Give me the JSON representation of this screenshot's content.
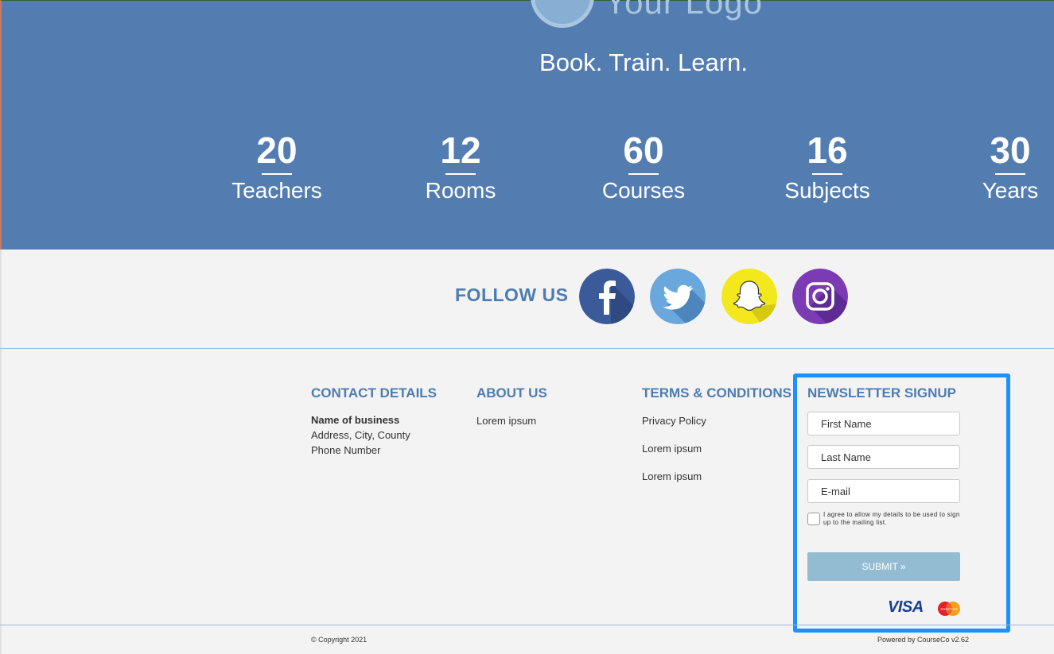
{
  "hero": {
    "logo_text": "Your Logo",
    "tagline": "Book. Train. Learn.",
    "stats": [
      {
        "number": "20",
        "label": "Teachers"
      },
      {
        "number": "12",
        "label": "Rooms"
      },
      {
        "number": "60",
        "label": "Courses"
      },
      {
        "number": "16",
        "label": "Subjects"
      },
      {
        "number": "30",
        "label": "Years"
      }
    ]
  },
  "follow": {
    "label": "FOLLOW US",
    "icons": [
      "facebook-icon",
      "twitter-icon",
      "snapchat-icon",
      "instagram-icon"
    ]
  },
  "contact": {
    "heading": "CONTACT DETAILS",
    "business_name": "Name of business",
    "address": "Address, City, County",
    "phone": "Phone Number"
  },
  "about": {
    "heading": "ABOUT US",
    "links": [
      "Lorem ipsum"
    ]
  },
  "terms": {
    "heading": "TERMS & CONDITIONS",
    "links": [
      "Privacy Policy",
      "Lorem ipsum",
      "Lorem ipsum"
    ]
  },
  "newsletter": {
    "heading": "NEWSLETTER SIGNUP",
    "first_name_placeholder": "First Name",
    "last_name_placeholder": "Last Name",
    "email_placeholder": "E-mail",
    "consent": "I agree to allow my details to be used to sign up to the mailing list.",
    "submit_label": "SUBMIT »",
    "payment_visa": "VISA",
    "payment_mastercard": "MasterCard"
  },
  "footer": {
    "copyright": "© Copyright 2021",
    "powered_by": "Powered by CourseCo v2.62"
  },
  "colors": {
    "hero_bg": "#537db0",
    "accent_blue": "#4e7cb1",
    "highlight_border": "#1e90ff",
    "submit_bg": "#93bcd3"
  }
}
